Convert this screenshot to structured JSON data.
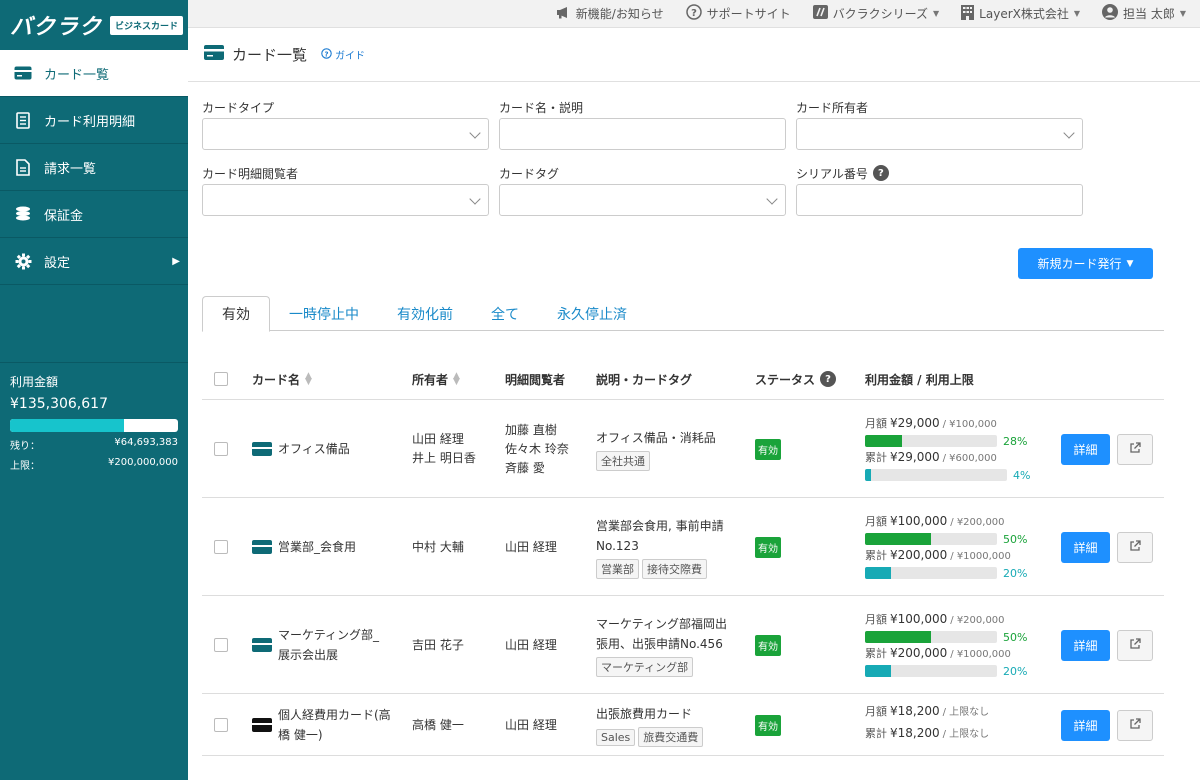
{
  "brand": {
    "logo": "バクラク",
    "logo_sub": "ビジネスカード"
  },
  "sidebar": {
    "items": [
      {
        "label": "カード一覧",
        "icon": "credit-card-icon",
        "active": true
      },
      {
        "label": "カード利用明細",
        "icon": "receipt-icon"
      },
      {
        "label": "請求一覧",
        "icon": "document-icon"
      },
      {
        "label": "保証金",
        "icon": "coins-icon"
      },
      {
        "label": "設定",
        "icon": "gear-icon",
        "has_submenu": true
      }
    ]
  },
  "usage": {
    "title": "利用金額",
    "amount": "¥135,306,617",
    "used_fraction": 0.68,
    "remaining_label": "残り：",
    "remaining": "¥64,693,383",
    "limit_label": "上限：",
    "limit": "¥200,000,000"
  },
  "topbar": {
    "items": [
      {
        "label": "新機能/お知らせ",
        "icon": "megaphone-icon"
      },
      {
        "label": "サポートサイト",
        "icon": "help-circle-icon"
      },
      {
        "label": "バクラクシリーズ",
        "icon": "bakuraku-icon",
        "dropdown": true
      },
      {
        "label": "LayerX株式会社",
        "icon": "building-icon",
        "dropdown": true
      },
      {
        "label": "担当 太郎",
        "icon": "user-avatar-icon",
        "dropdown": true
      }
    ]
  },
  "page": {
    "title": "カード一覧",
    "guide": "ガイド"
  },
  "filters": {
    "card_type": "カードタイプ",
    "card_name": "カード名・説明",
    "owner": "カード所有者",
    "viewer": "カード明細閲覧者",
    "tag": "カードタグ",
    "serial": "シリアル番号"
  },
  "new_card_button": "新規カード発行",
  "tabs": [
    "有効",
    "一時停止中",
    "有効化前",
    "全て",
    "永久停止済"
  ],
  "table": {
    "headers": {
      "name": "カード名",
      "owner": "所有者",
      "viewer": "明細閲覧者",
      "desc": "説明・カードタグ",
      "status": "ステータス",
      "amount": "利用金額 / 利用上限"
    },
    "detail_label": "詳細",
    "monthly_label": "月額",
    "total_label": "累計",
    "rows": [
      {
        "name": "オフィス備品",
        "owners": "山田 経理\n井上 明日香",
        "viewers": "加藤 直樹\n佐々木 玲奈\n斉藤 愛",
        "desc": "オフィス備品・消耗品",
        "tags": [
          "全社共通"
        ],
        "status": "有効",
        "monthly": "¥29,000",
        "monthly_limit": "/ ¥100,000",
        "monthly_pct": "28%",
        "monthly_frac": 0.28,
        "total": "¥29,000",
        "total_limit": "/ ¥600,000",
        "total_pct": "4%",
        "total_frac": 0.04
      },
      {
        "name": "営業部_会食用",
        "owners": "中村 大輔",
        "viewers": "山田 経理",
        "desc": "営業部会食用, 事前申請\nNo.123",
        "tags": [
          "営業部",
          "接待交際費"
        ],
        "status": "有効",
        "monthly": "¥100,000",
        "monthly_limit": "/ ¥200,000",
        "monthly_pct": "50%",
        "monthly_frac": 0.5,
        "total": "¥200,000",
        "total_limit": "/ ¥1000,000",
        "total_pct": "20%",
        "total_frac": 0.2
      },
      {
        "name": "マーケティング部_\n展示会出展",
        "owners": "吉田 花子",
        "viewers": "山田 経理",
        "desc": "マーケティング部福岡出\n張用、出張申請No.456",
        "tags": [
          "マーケティング部"
        ],
        "status": "有効",
        "monthly": "¥100,000",
        "monthly_limit": "/ ¥200,000",
        "monthly_pct": "50%",
        "monthly_frac": 0.5,
        "total": "¥200,000",
        "total_limit": "/ ¥1000,000",
        "total_pct": "20%",
        "total_frac": 0.2
      },
      {
        "name": "個人経費用カード(高\n橋 健一)",
        "owners": "高橋 健一",
        "viewers": "山田 経理",
        "desc": "出張旅費用カード",
        "tags": [
          "Sales",
          "旅費交通費"
        ],
        "status": "有効",
        "monthly": "¥18,200",
        "monthly_limit": "/ 上限なし",
        "total": "¥18,200",
        "total_limit": "/ 上限なし"
      }
    ]
  }
}
